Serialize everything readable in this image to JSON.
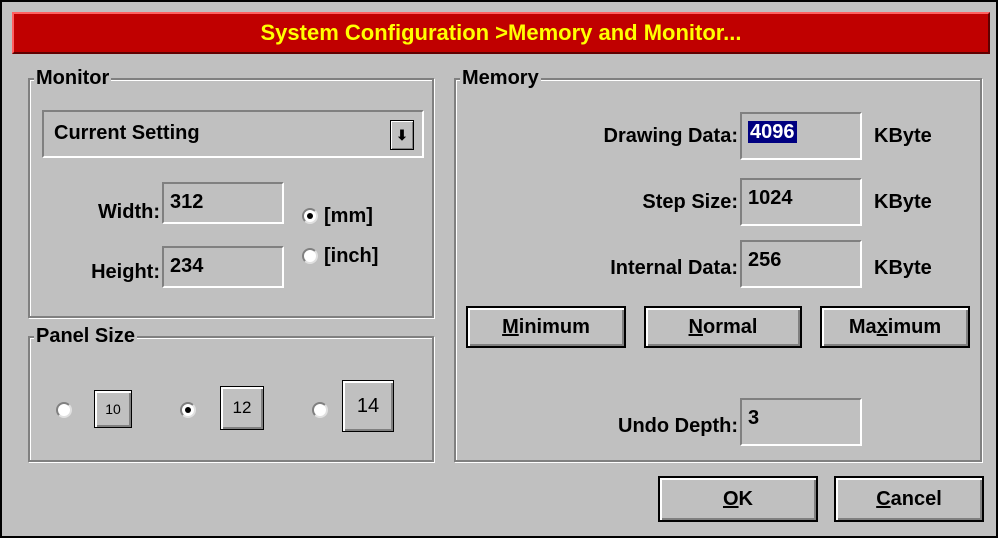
{
  "window": {
    "title": "System Configuration >Memory and Monitor..."
  },
  "monitor": {
    "group_label": "Monitor",
    "combo_value": "Current Setting",
    "width_label": "Width:",
    "width_value": "312",
    "height_label": "Height:",
    "height_value": "234",
    "unit_mm": "[mm]",
    "unit_inch": "[inch]",
    "selected_unit": "mm"
  },
  "panel_size": {
    "group_label": "Panel Size",
    "options": [
      "10",
      "12",
      "14"
    ],
    "selected": "12"
  },
  "memory": {
    "group_label": "Memory",
    "drawing_data_label": "Drawing Data:",
    "drawing_data_value": "4096",
    "step_size_label": "Step Size:",
    "step_size_value": "1024",
    "internal_data_label": "Internal Data:",
    "internal_data_value": "256",
    "unit": "KByte",
    "undo_depth_label": "Undo Depth:",
    "undo_depth_value": "3",
    "buttons": {
      "minimum_mnemonic": "M",
      "minimum_rest": "inimum",
      "normal_mnemonic": "N",
      "normal_rest": "ormal",
      "maximum_pre": "Ma",
      "maximum_mnemonic": "x",
      "maximum_rest": "imum"
    }
  },
  "dialog_buttons": {
    "ok_mnemonic": "O",
    "ok_rest": "K",
    "cancel_mnemonic": "C",
    "cancel_rest": "ancel"
  },
  "colors": {
    "title_bg": "#c00000",
    "title_text": "#ffff00",
    "face": "#c0c0c0",
    "selection": "#000080"
  }
}
